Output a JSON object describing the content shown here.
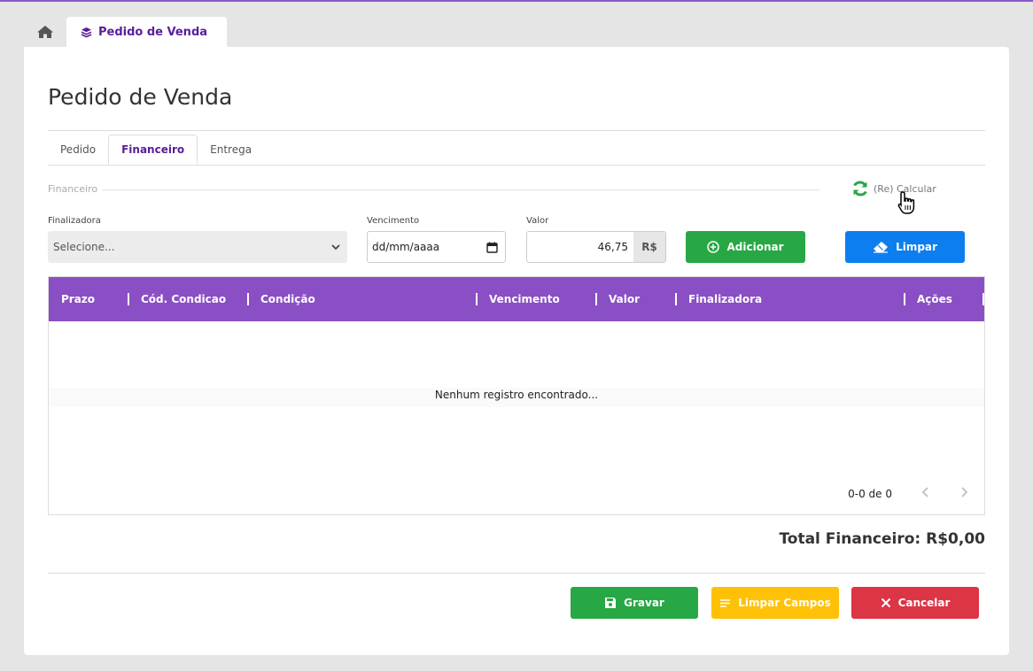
{
  "tabs": {
    "home_icon": "home-icon",
    "page_tab_label": "Pedido de Venda",
    "page_tab_icon": "layers-icon"
  },
  "page": {
    "title": "Pedido de Venda"
  },
  "subtabs": [
    {
      "label": "Pedido",
      "active": false
    },
    {
      "label": "Financeiro",
      "active": true
    },
    {
      "label": "Entrega",
      "active": false
    }
  ],
  "financeiro": {
    "section_label": "Financeiro",
    "recalc_label": "(Re) Calcular",
    "finalizadora_label": "Finalizadora",
    "finalizadora_placeholder": "Selecione...",
    "vencimento_label": "Vencimento",
    "vencimento_value": "dd/mm/aaaa",
    "valor_label": "Valor",
    "valor_value": "46,75",
    "valor_currency": "R$",
    "add_label": "Adicionar",
    "clear_label": "Limpar"
  },
  "table": {
    "columns": [
      "Prazo",
      "Cód. Condicao",
      "Condição",
      "Vencimento",
      "Valor",
      "Finalizadora",
      "Ações"
    ],
    "empty_text": "Nenhum registro encontrado...",
    "pagination": "0-0 de 0"
  },
  "total": {
    "text": "Total Financeiro: R$0,00"
  },
  "footer": {
    "save_label": "Gravar",
    "clear_fields_label": "Limpar Campos",
    "cancel_label": "Cancelar"
  },
  "colors": {
    "purple": "#8a4fc4",
    "green": "#28a745",
    "blue": "#0d7ef0",
    "yellow": "#ffc107",
    "red": "#dc3545"
  }
}
